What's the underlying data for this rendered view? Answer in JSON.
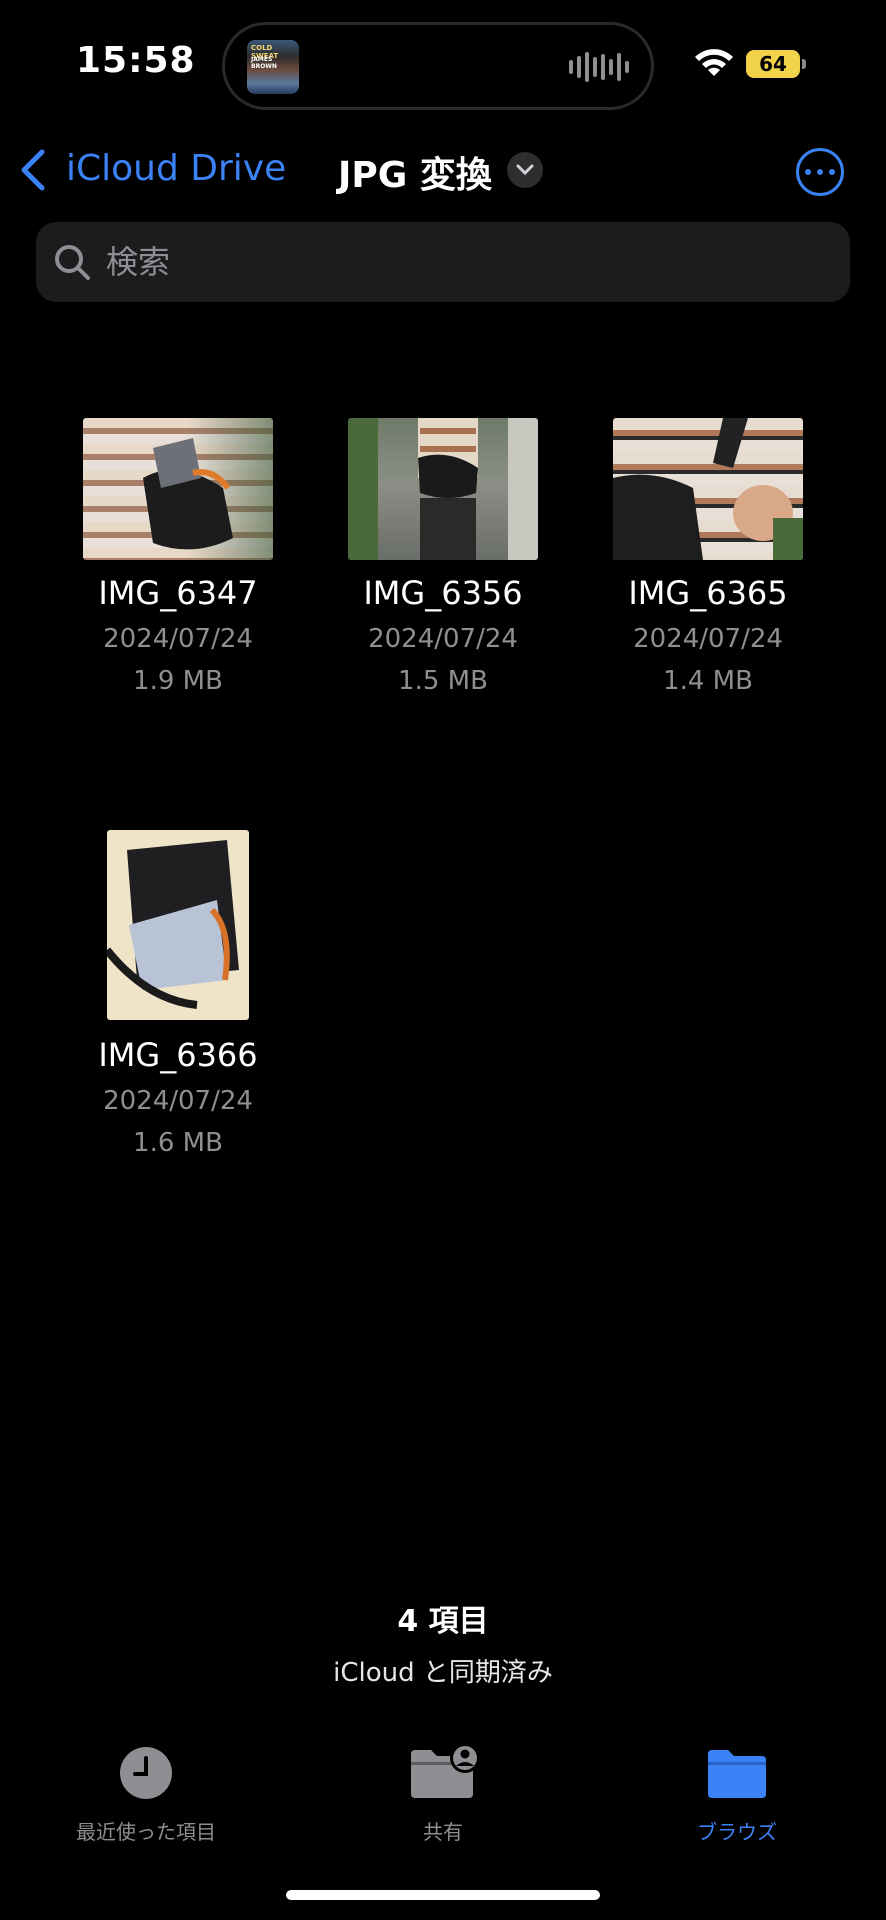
{
  "status_bar": {
    "time": "15:58",
    "now_playing_art_text": "COLD SWEAT",
    "now_playing_art_subtext": "JAMES BROWN",
    "battery": "64"
  },
  "nav": {
    "back_label": "iCloud Drive",
    "title": "JPG 変換"
  },
  "search": {
    "placeholder": "検索"
  },
  "files": [
    {
      "name": "IMG_6347",
      "date": "2024/07/24",
      "size": "1.9 MB"
    },
    {
      "name": "IMG_6356",
      "date": "2024/07/24",
      "size": "1.5 MB"
    },
    {
      "name": "IMG_6365",
      "date": "2024/07/24",
      "size": "1.4 MB"
    },
    {
      "name": "IMG_6366",
      "date": "2024/07/24",
      "size": "1.6 MB"
    }
  ],
  "footer": {
    "item_count": "4 項目",
    "sync_status": "iCloud と同期済み"
  },
  "tabs": [
    {
      "label": "最近使った項目",
      "icon": "clock-icon"
    },
    {
      "label": "共有",
      "icon": "shared-folder-icon"
    },
    {
      "label": "ブラウズ",
      "icon": "folder-icon"
    }
  ],
  "colors": {
    "accent": "#3b82f6",
    "battery": "#f2d249",
    "secondary_text": "#8e8e93",
    "search_bg": "#1c1c1e"
  }
}
